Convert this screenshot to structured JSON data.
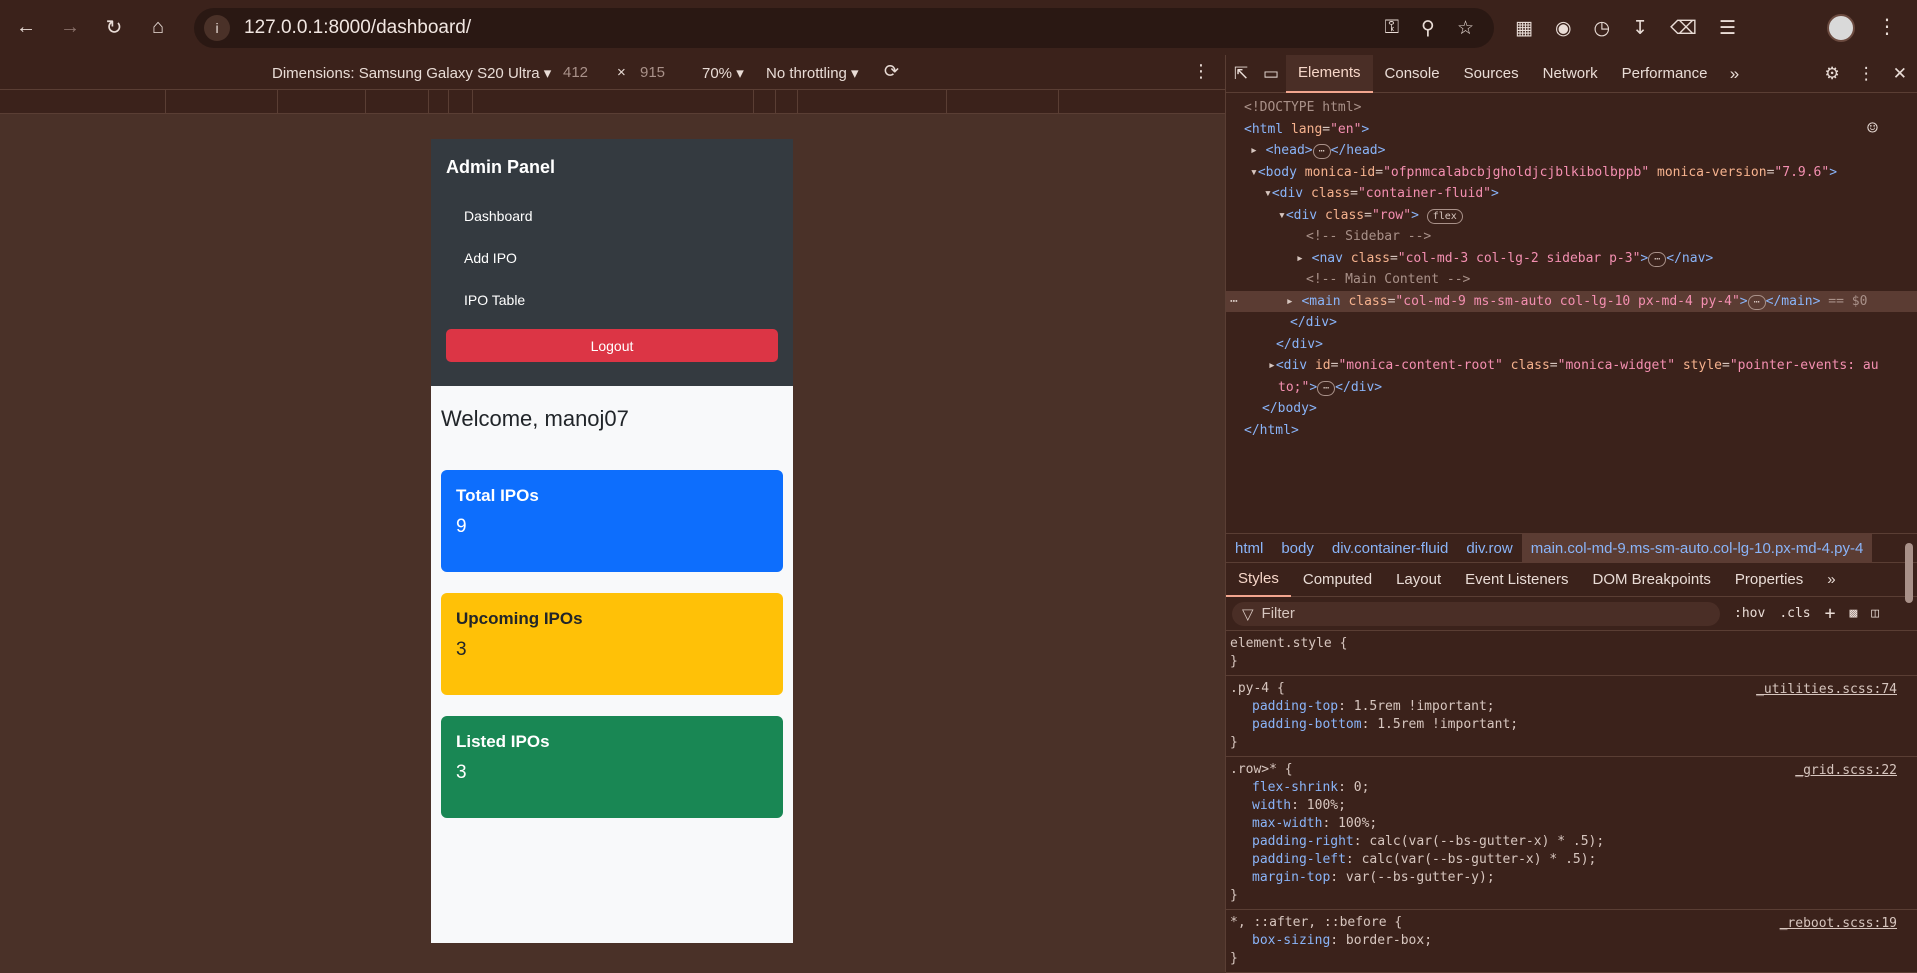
{
  "browser": {
    "url": "127.0.0.1:8000/dashboard/"
  },
  "device_toolbar": {
    "device_label": "Dimensions: Samsung Galaxy S20 Ultra",
    "width": "412",
    "times": "×",
    "height": "915",
    "zoom": "70%",
    "throttling": "No throttling"
  },
  "app": {
    "sidebar": {
      "title": "Admin Panel",
      "links": [
        "Dashboard",
        "Add IPO",
        "IPO Table"
      ],
      "logout_label": "Logout"
    },
    "welcome": "Welcome, manoj07",
    "cards": [
      {
        "title": "Total IPOs",
        "value": "9",
        "color": "#0d6efd"
      },
      {
        "title": "Upcoming IPOs",
        "value": "3",
        "color": "#ffc107"
      },
      {
        "title": "Listed IPOs",
        "value": "3",
        "color": "#198754"
      }
    ]
  },
  "devtools": {
    "tabs": [
      "Elements",
      "Console",
      "Sources",
      "Network",
      "Performance"
    ],
    "active_tab": "Elements",
    "breadcrumbs": [
      "html",
      "body",
      "div.container-fluid",
      "div.row",
      "main.col-md-9.ms-sm-auto.col-lg-10.px-md-4.py-4"
    ],
    "styles_tabs": [
      "Styles",
      "Computed",
      "Layout",
      "Event Listeners",
      "DOM Breakpoints",
      "Properties"
    ],
    "filter_placeholder": "Filter",
    "filter_tools": [
      ":hov",
      ".cls"
    ],
    "rules": [
      {
        "selector": "element.style {",
        "source": "",
        "decls": [],
        "close": "}"
      },
      {
        "selector": ".py-4 {",
        "source": "_utilities.scss:74",
        "decls": [
          [
            "padding-top",
            ": 1.5rem !important;"
          ],
          [
            "padding-bottom",
            ": 1.5rem !important;"
          ]
        ],
        "close": "}"
      },
      {
        "selector": ".row>* {",
        "source": "_grid.scss:22",
        "decls": [
          [
            "flex-shrink",
            ": 0;"
          ],
          [
            "width",
            ": 100%;"
          ],
          [
            "max-width",
            ": 100%;"
          ],
          [
            "padding-right",
            ": calc(var(--bs-gutter-x) * .5);"
          ],
          [
            "padding-left",
            ": calc(var(--bs-gutter-x) * .5);"
          ],
          [
            "margin-top",
            ": var(--bs-gutter-y);"
          ]
        ],
        "close": "}"
      },
      {
        "selector": "*, ::after, ::before {",
        "source": "_reboot.scss:19",
        "decls": [
          [
            "box-sizing",
            ": border-box;"
          ]
        ],
        "close": "}"
      }
    ]
  },
  "colors": {
    "sidebar_bg": "#343a40",
    "logout": "#dc3545",
    "browser_bg": "#3b221b"
  }
}
